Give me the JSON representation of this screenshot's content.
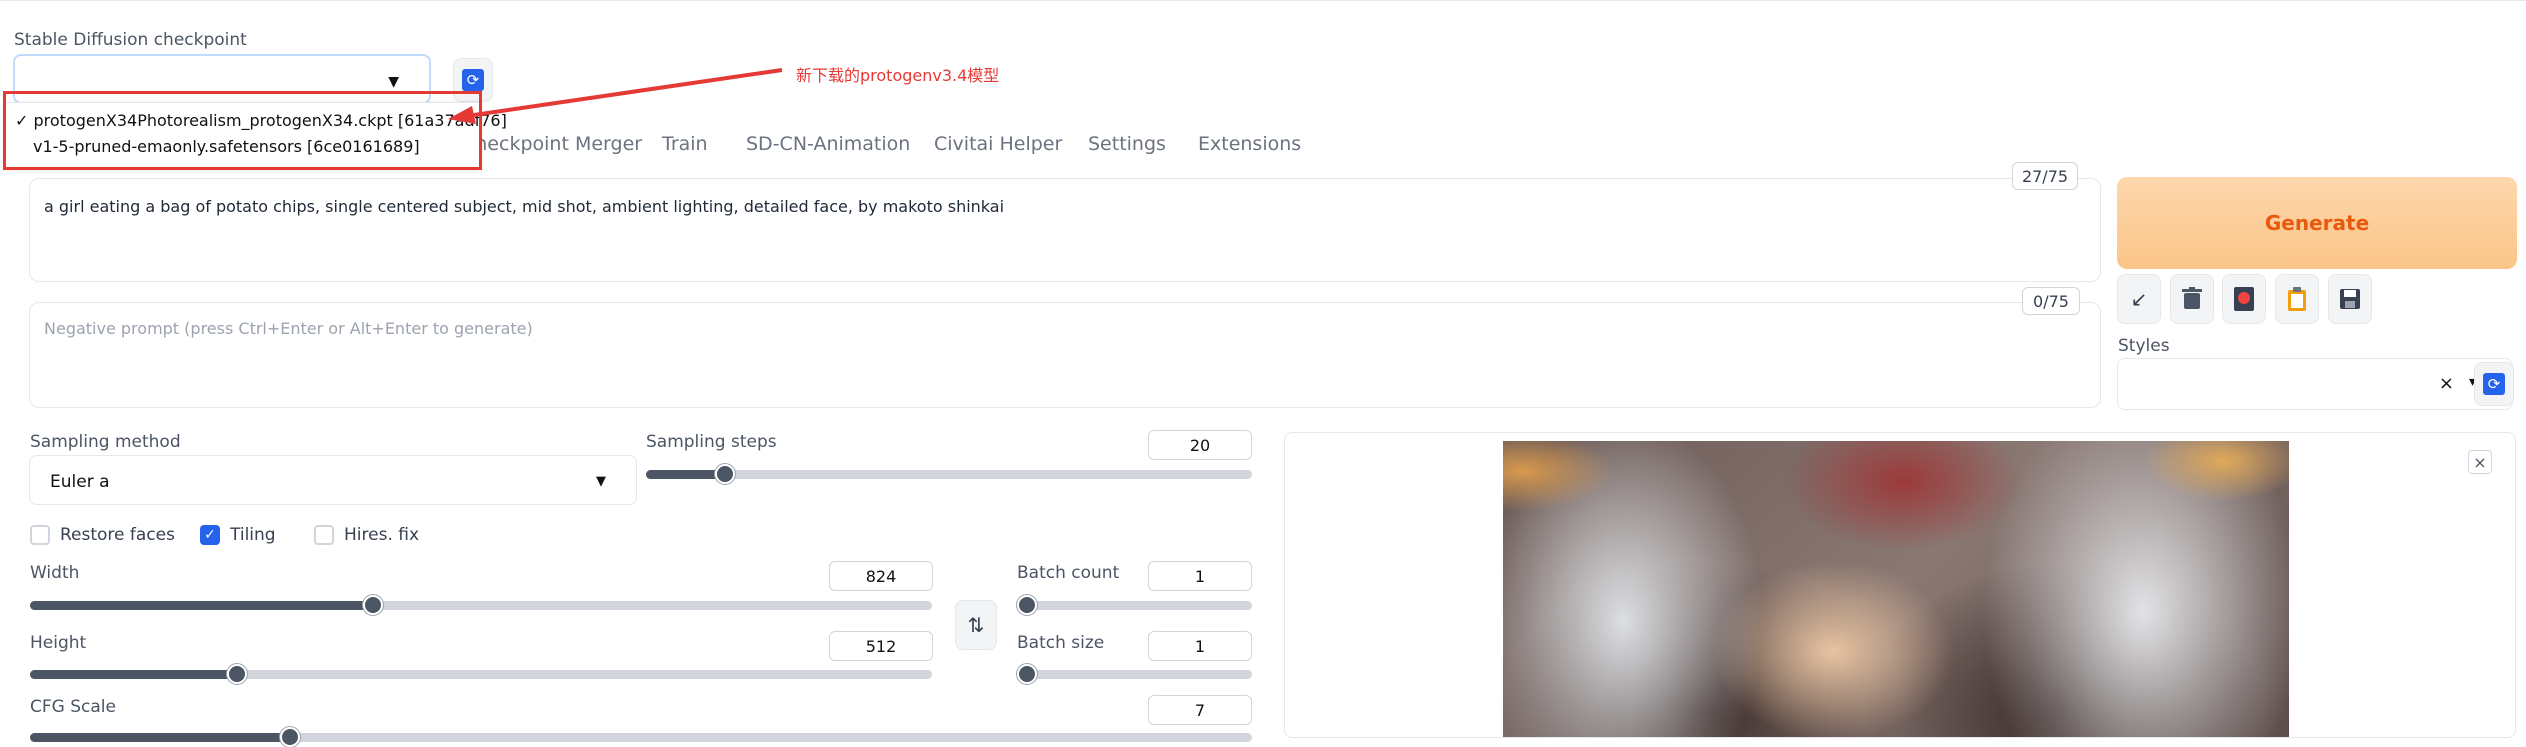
{
  "checkpoint": {
    "label": "Stable Diffusion checkpoint",
    "selected_value": "",
    "options": [
      {
        "check": "✓",
        "text": "protogenX34Photorealism_protogenX34.ckpt [61a37adf76]"
      },
      {
        "check": "",
        "text": "v1-5-pruned-emaonly.safetensors [6ce0161689]"
      }
    ]
  },
  "annotation": {
    "text": "新下载的protogenv3.4模型",
    "color": "#e53935"
  },
  "tabs": [
    "Checkpoint Merger",
    "Train",
    "SD-CN-Animation",
    "Civitai Helper",
    "Settings",
    "Extensions"
  ],
  "prompt": {
    "text": "a girl eating a bag of potato chips, single centered subject, mid shot, ambient lighting, detailed face, by makoto shinkai",
    "counter": "27/75"
  },
  "negative_prompt": {
    "placeholder": "Negative prompt (press Ctrl+Enter or Alt+Enter to generate)",
    "counter": "0/75"
  },
  "generate_label": "Generate",
  "tool_icons": [
    "arrow-icon",
    "trash-icon",
    "card-icon",
    "clipboard-icon",
    "save-icon"
  ],
  "styles": {
    "label": "Styles",
    "clear": "×",
    "caret": "▾"
  },
  "sampling": {
    "method_label": "Sampling method",
    "method_value": "Euler a",
    "steps_label": "Sampling steps",
    "steps_value": "20",
    "steps_fraction": 0.13
  },
  "options": {
    "restore_faces": {
      "label": "Restore faces",
      "checked": false
    },
    "tiling": {
      "label": "Tiling",
      "checked": true
    },
    "hires_fix": {
      "label": "Hires. fix",
      "checked": false
    }
  },
  "width": {
    "label": "Width",
    "value": "824",
    "fraction": 0.38
  },
  "height": {
    "label": "Height",
    "value": "512",
    "fraction": 0.23
  },
  "batch_count": {
    "label": "Batch count",
    "value": "1",
    "fraction": 0.0
  },
  "batch_size": {
    "label": "Batch size",
    "value": "1",
    "fraction": 0.0
  },
  "cfg_scale": {
    "label": "CFG Scale",
    "value": "7"
  },
  "colors": {
    "accent": "#2563eb",
    "generate_text": "#ea580c",
    "generate_bg": "#fbc587"
  }
}
